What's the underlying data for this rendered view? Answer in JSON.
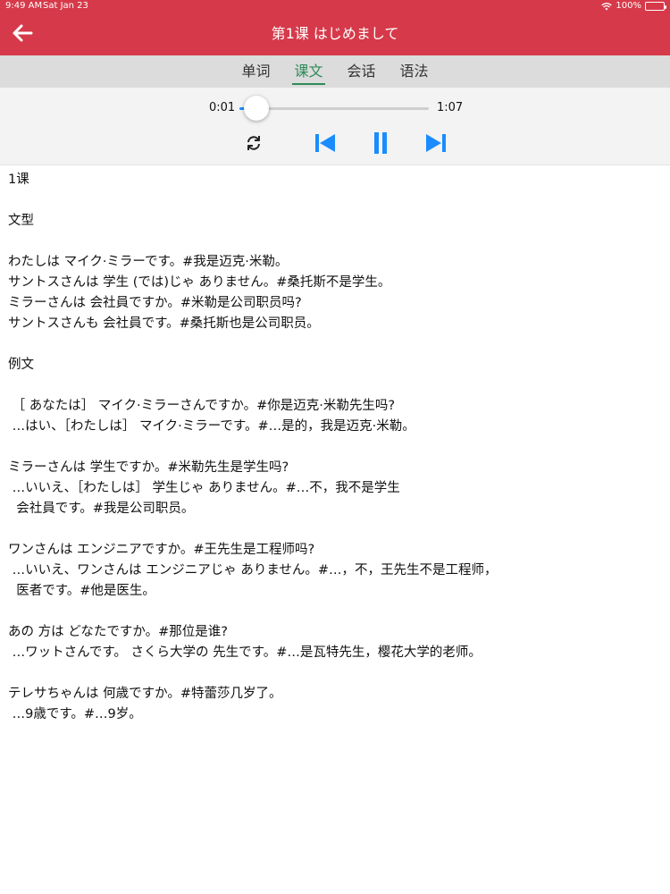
{
  "status_bar": {
    "time": "9:49 AM",
    "date": "Sat Jan 23",
    "battery": "100%"
  },
  "header": {
    "title": "第1课 はじめまして",
    "back_icon": "arrow-left-icon"
  },
  "tabs": [
    {
      "label": "单词",
      "active": false
    },
    {
      "label": "课文",
      "active": true
    },
    {
      "label": "会话",
      "active": false
    },
    {
      "label": "语法",
      "active": false
    }
  ],
  "player": {
    "current_time": "0:01",
    "duration": "1:07",
    "progress": 0.015,
    "icons": [
      "repeat-icon",
      "skip-previous-icon",
      "pause-icon",
      "skip-next-icon"
    ]
  },
  "colors": {
    "header": "#d63a4a",
    "active_tab": "#2e8b57",
    "accent": "#1a8cff"
  },
  "content": {
    "lines": [
      "1课",
      "",
      "文型",
      "",
      "わたしは マイク·ミラーです。#我是迈克·米勒。",
      "サントスさんは 学生 (では)じゃ ありません。#桑托斯不是学生。",
      "ミラーさんは 会社員ですか。#米勒是公司职员吗?",
      "サントスさんも 会社員です。#桑托斯也是公司职员。",
      "",
      "例文",
      "",
      " ［ あなたは］ マイク·ミラーさんですか。#你是迈克·米勒先生吗?",
      " …はい、［わたしは］ マイク·ミラーです。#…是的，我是迈克·米勒。",
      "",
      "ミラーさんは 学生ですか。#米勒先生是学生吗?",
      " …いいえ、［わたしは］ 学生じゃ ありません。#…不，我不是学生",
      "  会社員です。#我是公司职员。",
      "",
      "ワンさんは エンジニアですか。#王先生是工程师吗?",
      " …いいえ、ワンさんは エンジニアじゃ ありません。#…，不，王先生不是工程师，",
      "  医者です。#他是医生。",
      "",
      "あの 方は どなたですか。#那位是谁?",
      " …ワットさんです。 さくら大学の 先生です。#…是瓦特先生，樱花大学的老师。",
      "",
      "テレサちゃんは 何歳ですか。#特蕾莎几岁了。",
      " …9歳です。#…9岁。"
    ]
  }
}
